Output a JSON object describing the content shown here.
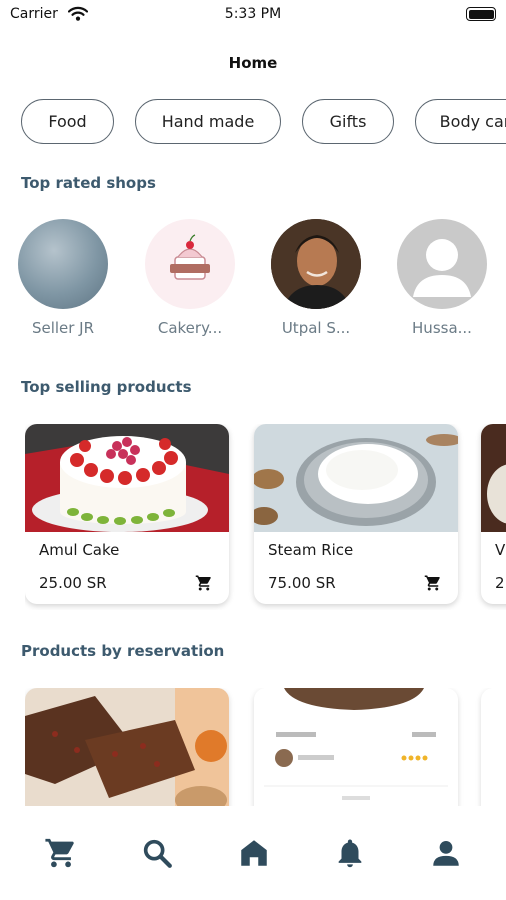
{
  "status_bar": {
    "carrier": "Carrier",
    "time": "5:33 PM",
    "icons": [
      "wifi-icon",
      "battery-icon"
    ]
  },
  "header": {
    "title": "Home"
  },
  "categories": [
    {
      "label": "Food"
    },
    {
      "label": "Hand made"
    },
    {
      "label": "Gifts"
    },
    {
      "label": "Body car"
    }
  ],
  "sections": {
    "top_rated_shops": "Top rated shops",
    "top_selling_products": "Top selling products",
    "products_by_reservation": "Products by reservation"
  },
  "shops": [
    {
      "name": "Seller JR",
      "avatar": "gray-gradient-photo"
    },
    {
      "name": "Cakery...",
      "avatar": "cake-shop-logo"
    },
    {
      "name": "Utpal S...",
      "avatar": "person-photo"
    },
    {
      "name": "Hussa...",
      "avatar": "default-person-icon"
    }
  ],
  "top_selling": [
    {
      "name": "Amul Cake",
      "price": "25.00 SR",
      "image": "strawberry-cake-photo"
    },
    {
      "name": "Steam Rice",
      "price": "75.00 SR",
      "image": "rice-bowl-photo"
    },
    {
      "name": "V",
      "price": "2",
      "image": "chocolate-dessert-photo"
    }
  ],
  "reservations": [
    {
      "image": "fruit-cake-photo"
    },
    {
      "image": "dessert-card-thumbnail"
    },
    {
      "image": "partial-card"
    }
  ],
  "tab_bar": [
    {
      "icon": "cart-icon",
      "active": false
    },
    {
      "icon": "search-icon",
      "active": false
    },
    {
      "icon": "home-icon",
      "active": true
    },
    {
      "icon": "bell-icon",
      "active": false
    },
    {
      "icon": "profile-icon",
      "active": false
    }
  ],
  "colors": {
    "accent": "#3d5a6e",
    "tab_icon": "#2f4b5c",
    "chip_border": "#5b6670",
    "shop_name": "#6b7b86"
  }
}
